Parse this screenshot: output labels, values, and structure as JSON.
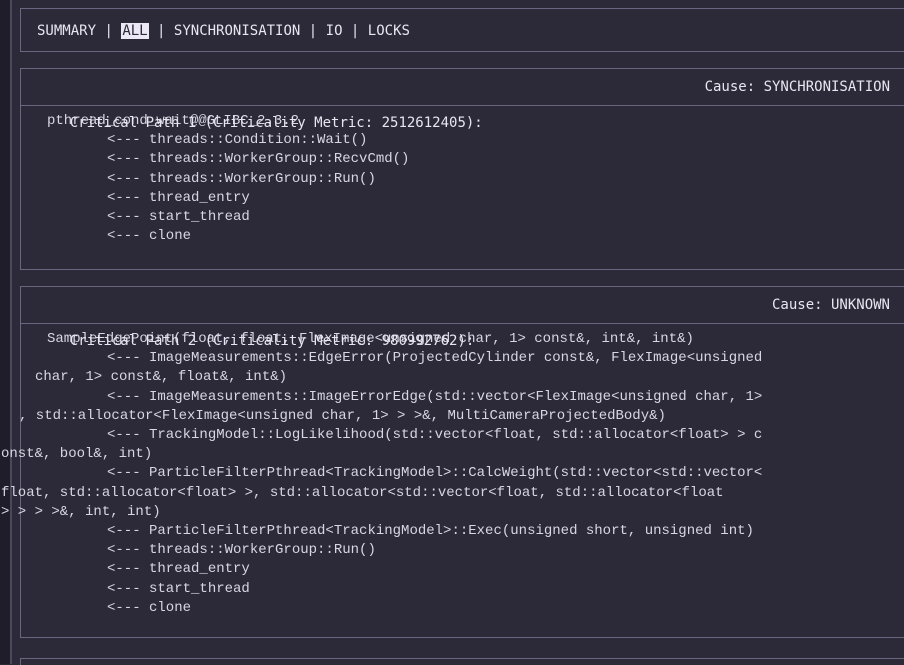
{
  "tabs": {
    "summary": "SUMMARY",
    "all": "ALL",
    "sync": "SYNCHRONISATION",
    "io": "IO",
    "locks": "LOCKS",
    "separator": " | "
  },
  "paths": [
    {
      "title": "Critical Path 1 (Criticality Metric: 2512612405):",
      "cause": "Cause: SYNCHRONISATION",
      "lines": [
        "pthread_cond_wait@@GLIBC_2.3.2",
        "<--- threads::Condition::Wait()",
        "<--- threads::WorkerGroup::RecvCmd()",
        "<--- threads::WorkerGroup::Run()",
        "<--- thread_entry",
        "<--- start_thread",
        "<--- clone"
      ]
    },
    {
      "title": "Critical Path 2 (Criticality Metric: 980992762):",
      "cause": "Cause: UNKNOWN",
      "lines": [
        "SampleEdgePoint(float, float, FlexImage<unsigned char, 1> const&, int&, int&)",
        "<--- ImageMeasurements::EdgeError(ProjectedCylinder const&, FlexImage<unsigned",
        "char, 1> const&, float&, int&)",
        "<--- ImageMeasurements::ImageErrorEdge(std::vector<FlexImage<unsigned char, 1>",
        ", std::allocator<FlexImage<unsigned char, 1> > >&, MultiCameraProjectedBody&)",
        "<--- TrackingModel::LogLikelihood(std::vector<float, std::allocator<float> > c",
        "onst&, bool&, int)",
        "<--- ParticleFilterPthread<TrackingModel>::CalcWeight(std::vector<std::vector<",
        "float, std::allocator<float> >, std::allocator<std::vector<float, std::allocator<float",
        "> > > >&, int, int)",
        "<--- ParticleFilterPthread<TrackingModel>::Exec(unsigned short, unsigned int)",
        "<--- threads::WorkerGroup::Run()",
        "<--- thread_entry",
        "<--- start_thread",
        "<--- clone"
      ]
    }
  ]
}
